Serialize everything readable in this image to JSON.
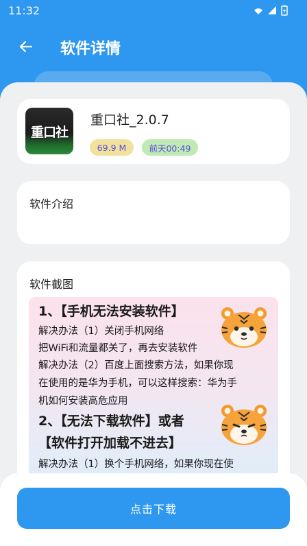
{
  "status_bar": {
    "time": "11:32"
  },
  "header": {
    "title": "软件详情"
  },
  "app": {
    "name": "重口社_2.0.7",
    "icon_text": "重口社",
    "size": "69.9 M",
    "updated": "前天00:49"
  },
  "sections": {
    "intro_title": "软件介绍",
    "screenshots_title": "软件截图"
  },
  "screenshot_text": {
    "heading1": "1、【手机无法安装软件】",
    "line1": "解决办法（1）关闭手机网络",
    "line2": "把WiFi和流量都关了，再去安装软件",
    "line3": "解决办法（2）百度上面搜索方法，如果你现",
    "line4": "在使用的是华为手机，可以这样搜索：华为手",
    "line5": "机如何安装高危应用",
    "heading2": "2、【无法下载软件】或者",
    "heading3": "【软件打开加载不进去】",
    "line6": "解决办法（1）换个手机网络，如果你现在使"
  },
  "actions": {
    "download_label": "点击下载"
  },
  "colors": {
    "primary": "#2e97ef",
    "background": "#eff0f2",
    "badge_size_bg": "#f1e19c",
    "badge_time_bg": "#bfeab3"
  }
}
